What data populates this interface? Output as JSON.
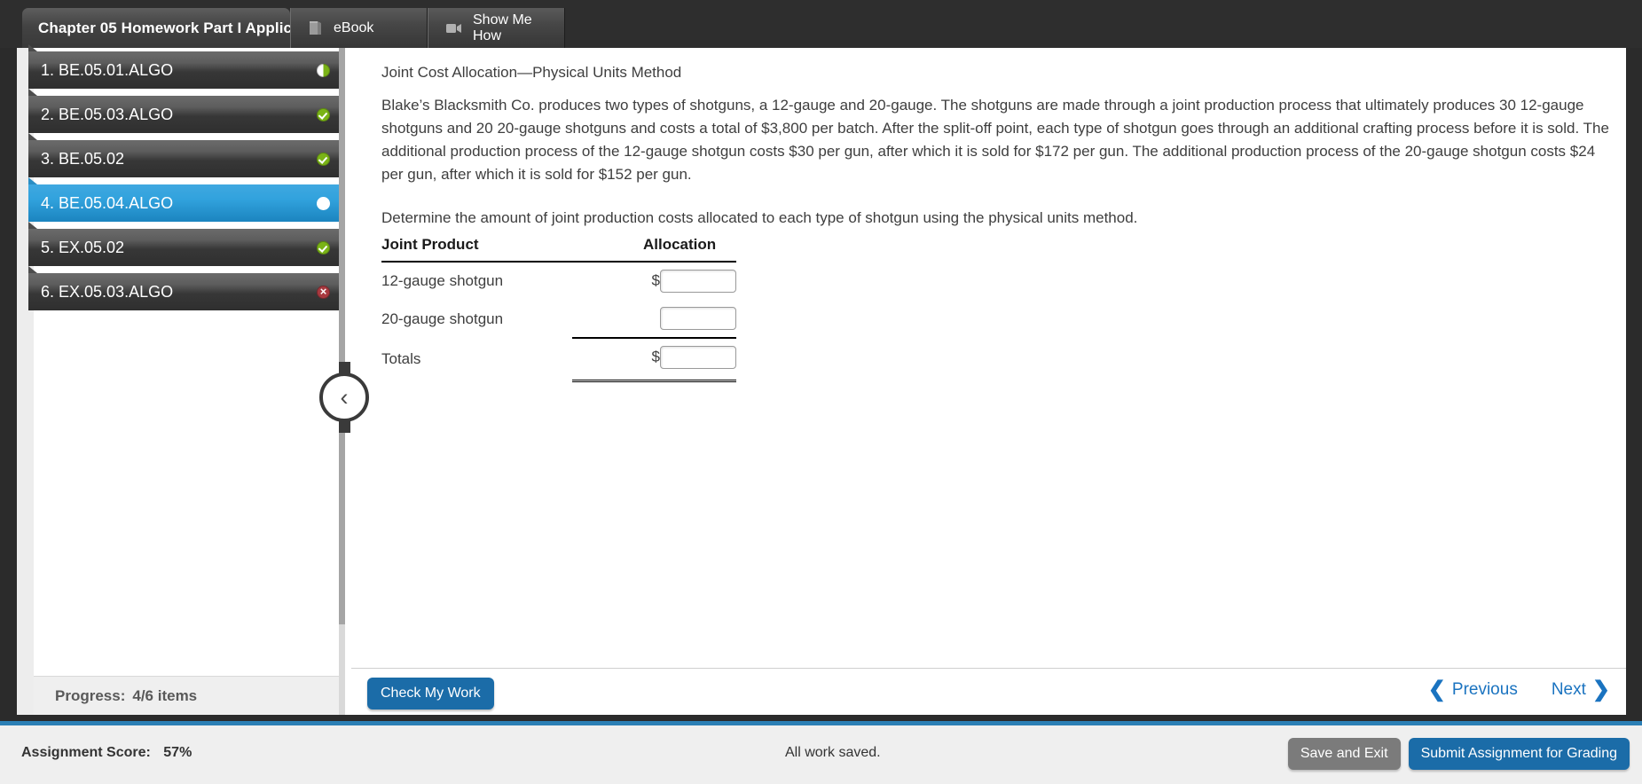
{
  "header": {
    "assignment_tab": "Chapter 05 Homework Part I Applic:",
    "tabs": [
      {
        "label": "eBook",
        "icon": "book-icon"
      },
      {
        "label": "Show Me How",
        "icon": "video-camera-icon"
      }
    ]
  },
  "sidebar": {
    "items": [
      {
        "number": "1.",
        "label": "1. BE.05.01.ALGO",
        "status": "partial"
      },
      {
        "number": "2.",
        "label": "2. BE.05.03.ALGO",
        "status": "complete"
      },
      {
        "number": "3.",
        "label": "3. BE.05.02",
        "status": "complete"
      },
      {
        "number": "4.",
        "label": "4. BE.05.04.ALGO",
        "status": "current"
      },
      {
        "number": "5.",
        "label": "5. EX.05.02",
        "status": "complete"
      },
      {
        "number": "6.",
        "label": "6. EX.05.03.ALGO",
        "status": "incorrect"
      }
    ],
    "progress_label": "Progress:",
    "progress_value": "4/6 items",
    "collapse_icon": "chevron-left-icon"
  },
  "question": {
    "title": "Joint Cost Allocation—Physical Units Method",
    "body": "Blake’s Blacksmith Co. produces two types of shotguns, a 12-gauge and 20-gauge. The shotguns are made through a joint production process that ultimately produces 30 12-gauge shotguns and 20 20-gauge shotguns and costs a total of $3,800 per batch. After the split-off point, each type of shotgun goes through an additional crafting process before it is sold. The additional production process of the 12-gauge shotgun costs $30 per gun, after which it is sold for $172 per gun. The additional production process of the 20-gauge shotgun costs $24 per gun, after which it is sold for $152 per gun.",
    "instruction": "Determine the amount of joint production costs allocated to each type of shotgun using the physical units method.",
    "table": {
      "headers": [
        "Joint Product",
        "Allocation"
      ],
      "rows": [
        {
          "label": "12-gauge shotgun",
          "currency": "$",
          "value": "",
          "placeholder": ""
        },
        {
          "label": "20-gauge shotgun",
          "currency": "",
          "value": "",
          "placeholder": ""
        },
        {
          "label": "Totals",
          "currency": "$",
          "value": "",
          "placeholder": ""
        }
      ]
    }
  },
  "footer": {
    "check_my_work": "Check My Work",
    "previous": "Previous",
    "next": "Next",
    "prev_icon": "chevron-left-icon",
    "next_icon": "chevron-right-icon"
  },
  "status": {
    "score_label": "Assignment Score:",
    "score_value": "57%",
    "save_message": "All work saved.",
    "save_and_exit": "Save and Exit",
    "submit": "Submit Assignment for Grading"
  },
  "colors": {
    "accent_blue": "#1b6ca8",
    "selected_item": "#2d9cd6",
    "complete_green": "#7ab317",
    "incorrect_red": "#a8393f",
    "link_blue": "#1a73c0"
  }
}
